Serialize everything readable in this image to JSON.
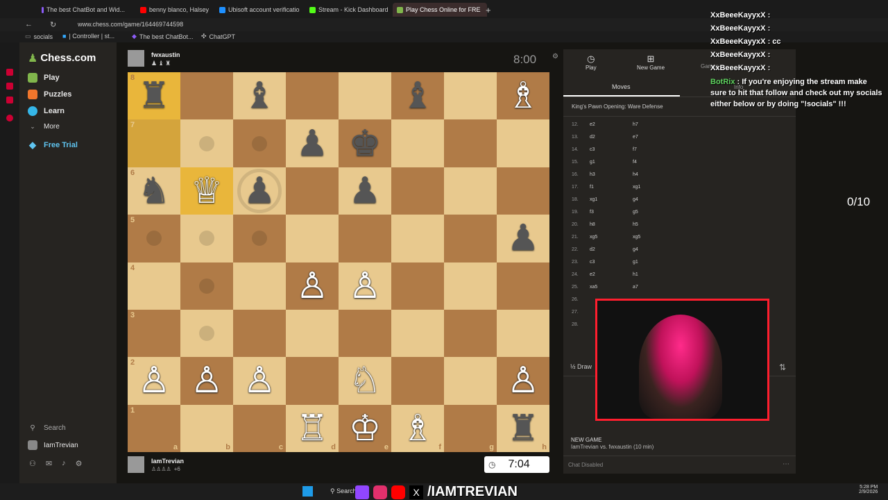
{
  "browser": {
    "tabs": [
      {
        "label": "The best ChatBot and Wid...",
        "color": "#8b5cf6"
      },
      {
        "label": "benny blanco, Halsey",
        "color": "#ff0000"
      },
      {
        "label": "Ubisoft account verificatio",
        "color": "#1e90ff"
      },
      {
        "label": "Stream - Kick Dashboard",
        "color": "#53fc18"
      },
      {
        "label": "Play Chess Online for FRE",
        "color": "#81b64c"
      }
    ],
    "new_tab": "+",
    "url": "www.chess.com/game/164469744598",
    "bookmarks": [
      "socials",
      "| Controller | st...",
      "The best ChatBot...",
      "ChatGPT"
    ]
  },
  "sidebar": {
    "logo": "Chess.com",
    "items": [
      {
        "label": "Play",
        "color": "#81b64c"
      },
      {
        "label": "Puzzles",
        "color": "#f0762c"
      },
      {
        "label": "Learn",
        "color": "#35b6e8"
      },
      {
        "label": "More",
        "color": "#888888"
      },
      {
        "label": "Free Trial",
        "color": "#5fc4f0"
      }
    ],
    "search": "Search",
    "user": "IamTrevian"
  },
  "game": {
    "opponent": {
      "name": "fwxaustin",
      "clock": "8:00"
    },
    "player": {
      "name": "IamTrevian",
      "clock": "7:04",
      "captured": "+6"
    },
    "ranks": [
      "8",
      "7",
      "6",
      "5",
      "4",
      "3",
      "2",
      "1"
    ],
    "files": [
      "a",
      "b",
      "c",
      "d",
      "e",
      "f",
      "g",
      "h"
    ]
  },
  "board": [
    [
      "♜",
      "",
      "♝",
      "",
      "",
      "♝",
      "",
      "♗"
    ],
    [
      "",
      "",
      "",
      "♟",
      "♚",
      "",
      "",
      ""
    ],
    [
      "♞",
      "♕",
      "♟",
      "",
      "♟",
      "",
      "",
      ""
    ],
    [
      "",
      "",
      "",
      "",
      "",
      "",
      "",
      "♟"
    ],
    [
      "",
      "",
      "",
      "♙",
      "♙",
      "",
      "",
      ""
    ],
    [
      "",
      "",
      "",
      "",
      "",
      "",
      "",
      ""
    ],
    [
      "♙",
      "♙",
      "♙",
      "",
      "♘",
      "",
      "",
      "♙"
    ],
    [
      "",
      "",
      "",
      "♖",
      "♔",
      "♗",
      "",
      "♜"
    ]
  ],
  "panel": {
    "tabs": [
      "Play",
      "New Game",
      "Games",
      "Info"
    ],
    "section": "Moves",
    "opening": "King's Pawn Opening: Ware Defense",
    "moves": [
      {
        "n": "12.",
        "w": "e2",
        "b": "h7"
      },
      {
        "n": "13.",
        "w": "d2",
        "b": "e7"
      },
      {
        "n": "14.",
        "w": "c3",
        "b": "f7"
      },
      {
        "n": "15.",
        "w": "g1",
        "b": "f4"
      },
      {
        "n": "16.",
        "w": "h3",
        "b": "h4"
      },
      {
        "n": "17.",
        "w": "f1",
        "b": "xg1"
      },
      {
        "n": "18.",
        "w": "xg1",
        "b": "g4"
      },
      {
        "n": "19.",
        "w": "f3",
        "b": "g5"
      },
      {
        "n": "20.",
        "w": "h8",
        "b": "h5"
      },
      {
        "n": "21.",
        "w": "xg5",
        "b": "xg5"
      },
      {
        "n": "22.",
        "w": "d2",
        "b": "g4"
      },
      {
        "n": "23.",
        "w": "c3",
        "b": "g1"
      },
      {
        "n": "24.",
        "w": "e2",
        "b": "h1"
      },
      {
        "n": "25.",
        "w": "xa5",
        "b": "a7"
      },
      {
        "n": "26.",
        "w": "",
        "b": ""
      },
      {
        "n": "27.",
        "w": "",
        "b": ""
      },
      {
        "n": "28.",
        "w": "",
        "b": ""
      }
    ],
    "draw": "½ Draw",
    "new_game_title": "NEW GAME",
    "new_game_desc": "IamTrevian vs. fwxaustin (10 min)",
    "chat_status": "Chat Disabled"
  },
  "overlay": {
    "chat": [
      {
        "user": "XxBeeeKayyxX",
        "msg": ""
      },
      {
        "user": "XxBeeeKayyxX",
        "msg": ""
      },
      {
        "user": "XxBeeeKayyxX",
        "msg": "cc"
      },
      {
        "user": "XxBeeeKayyxX",
        "msg": ""
      },
      {
        "user": "XxBeeeKayyxX",
        "msg": ""
      },
      {
        "user": "BotRix",
        "msg": "If you're enjoying the stream make sure to hit that follow and check out my socials either below or by doing \"!socials\" !!!"
      }
    ],
    "counter": "0/10",
    "handle": "/IAMTREVIAN"
  },
  "taskbar": {
    "search": "Search",
    "time": "5:28 PM",
    "date": "2/9/2026"
  }
}
